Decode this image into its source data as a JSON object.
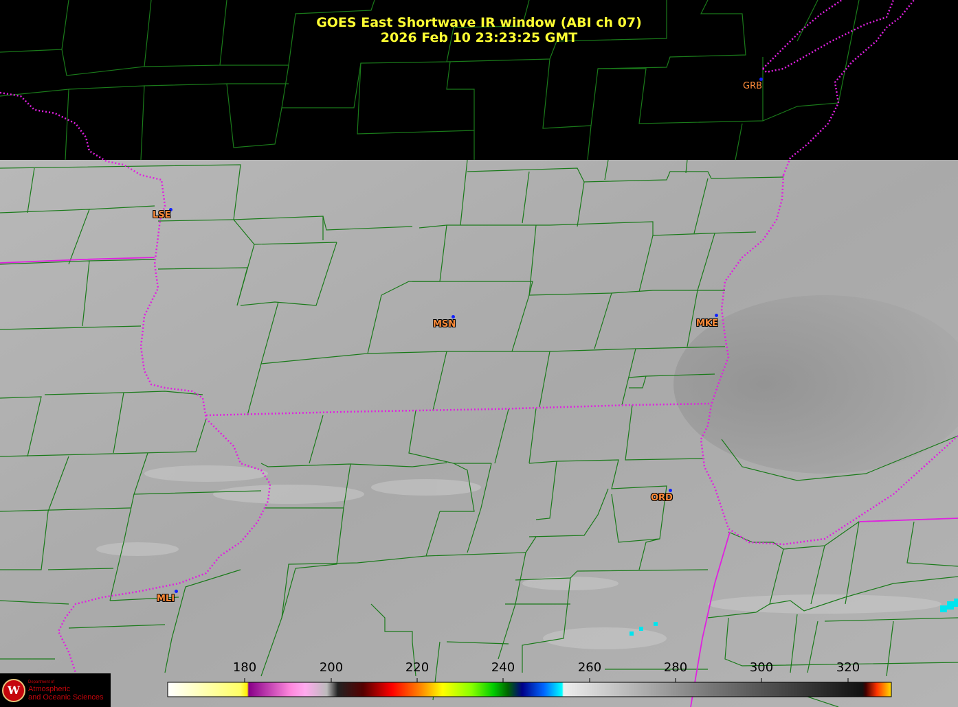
{
  "title": {
    "line1": "GOES East Shortwave IR window (ABI ch 07)",
    "line2": "2026 Feb 10  23:23:25 GMT"
  },
  "stations": [
    {
      "id": "GRB",
      "style": "plain"
    },
    {
      "id": "LSE",
      "style": "outlined"
    },
    {
      "id": "MSN",
      "style": "outlined"
    },
    {
      "id": "MKE",
      "style": "outlined"
    },
    {
      "id": "ORD",
      "style": "outlined"
    },
    {
      "id": "MLI",
      "style": "outlined"
    }
  ],
  "colorbar": {
    "ticks": [
      "180",
      "200",
      "220",
      "240",
      "260",
      "280",
      "300",
      "320"
    ],
    "min_value": 163,
    "max_value": 330
  },
  "colors": {
    "title": "#ffff33",
    "county_lines": "#1a7a1a",
    "state_borders": "#e020e0",
    "station_label": "#ff8c3a",
    "station_dot": "#1122ff"
  },
  "logo": {
    "small_text": "Department of",
    "line1": "Atmospheric",
    "line2": "and Oceanic Sciences",
    "seal": "W"
  }
}
